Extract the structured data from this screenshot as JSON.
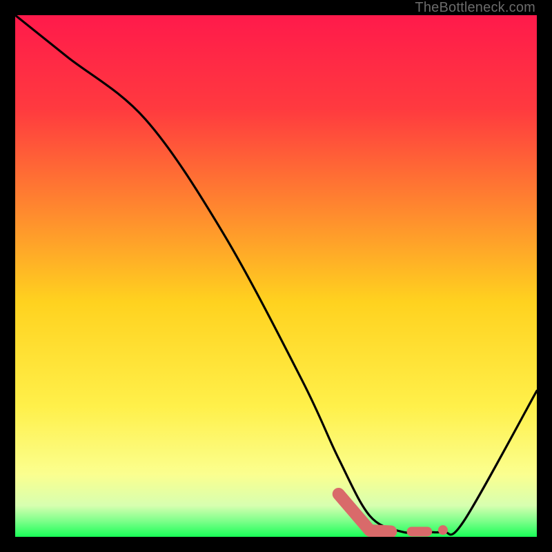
{
  "watermark": "TheBottleneck.com",
  "colors": {
    "frame": "#000000",
    "curve": "#000000",
    "marker": "#d96a6a",
    "gradient_top": "#ff1a4b",
    "gradient_mid_upper": "#ff7a33",
    "gradient_mid": "#ffd21f",
    "gradient_mid_lower": "#fff56b",
    "gradient_low": "#f7ffb0",
    "gradient_bottom": "#19ff57"
  },
  "chart_data": {
    "type": "line",
    "title": "",
    "xlabel": "",
    "ylabel": "",
    "xlim": [
      0,
      100
    ],
    "ylim": [
      0,
      100
    ],
    "series": [
      {
        "name": "bottleneck-curve",
        "x": [
          0,
          10,
          25,
          40,
          55,
          62,
          68,
          74,
          78,
          82,
          86,
          100
        ],
        "y": [
          100,
          92,
          80,
          58,
          30,
          15,
          4,
          1,
          1,
          1,
          3,
          28
        ]
      }
    ],
    "markers": {
      "name": "optimal-range",
      "points": [
        {
          "x": 62,
          "y": 4.5
        },
        {
          "x": 68,
          "y": 1.2
        },
        {
          "x": 72,
          "y": 1.0
        },
        {
          "x": 76,
          "y": 1.0
        },
        {
          "x": 79,
          "y": 1.0
        },
        {
          "x": 82,
          "y": 1.3
        }
      ]
    }
  }
}
